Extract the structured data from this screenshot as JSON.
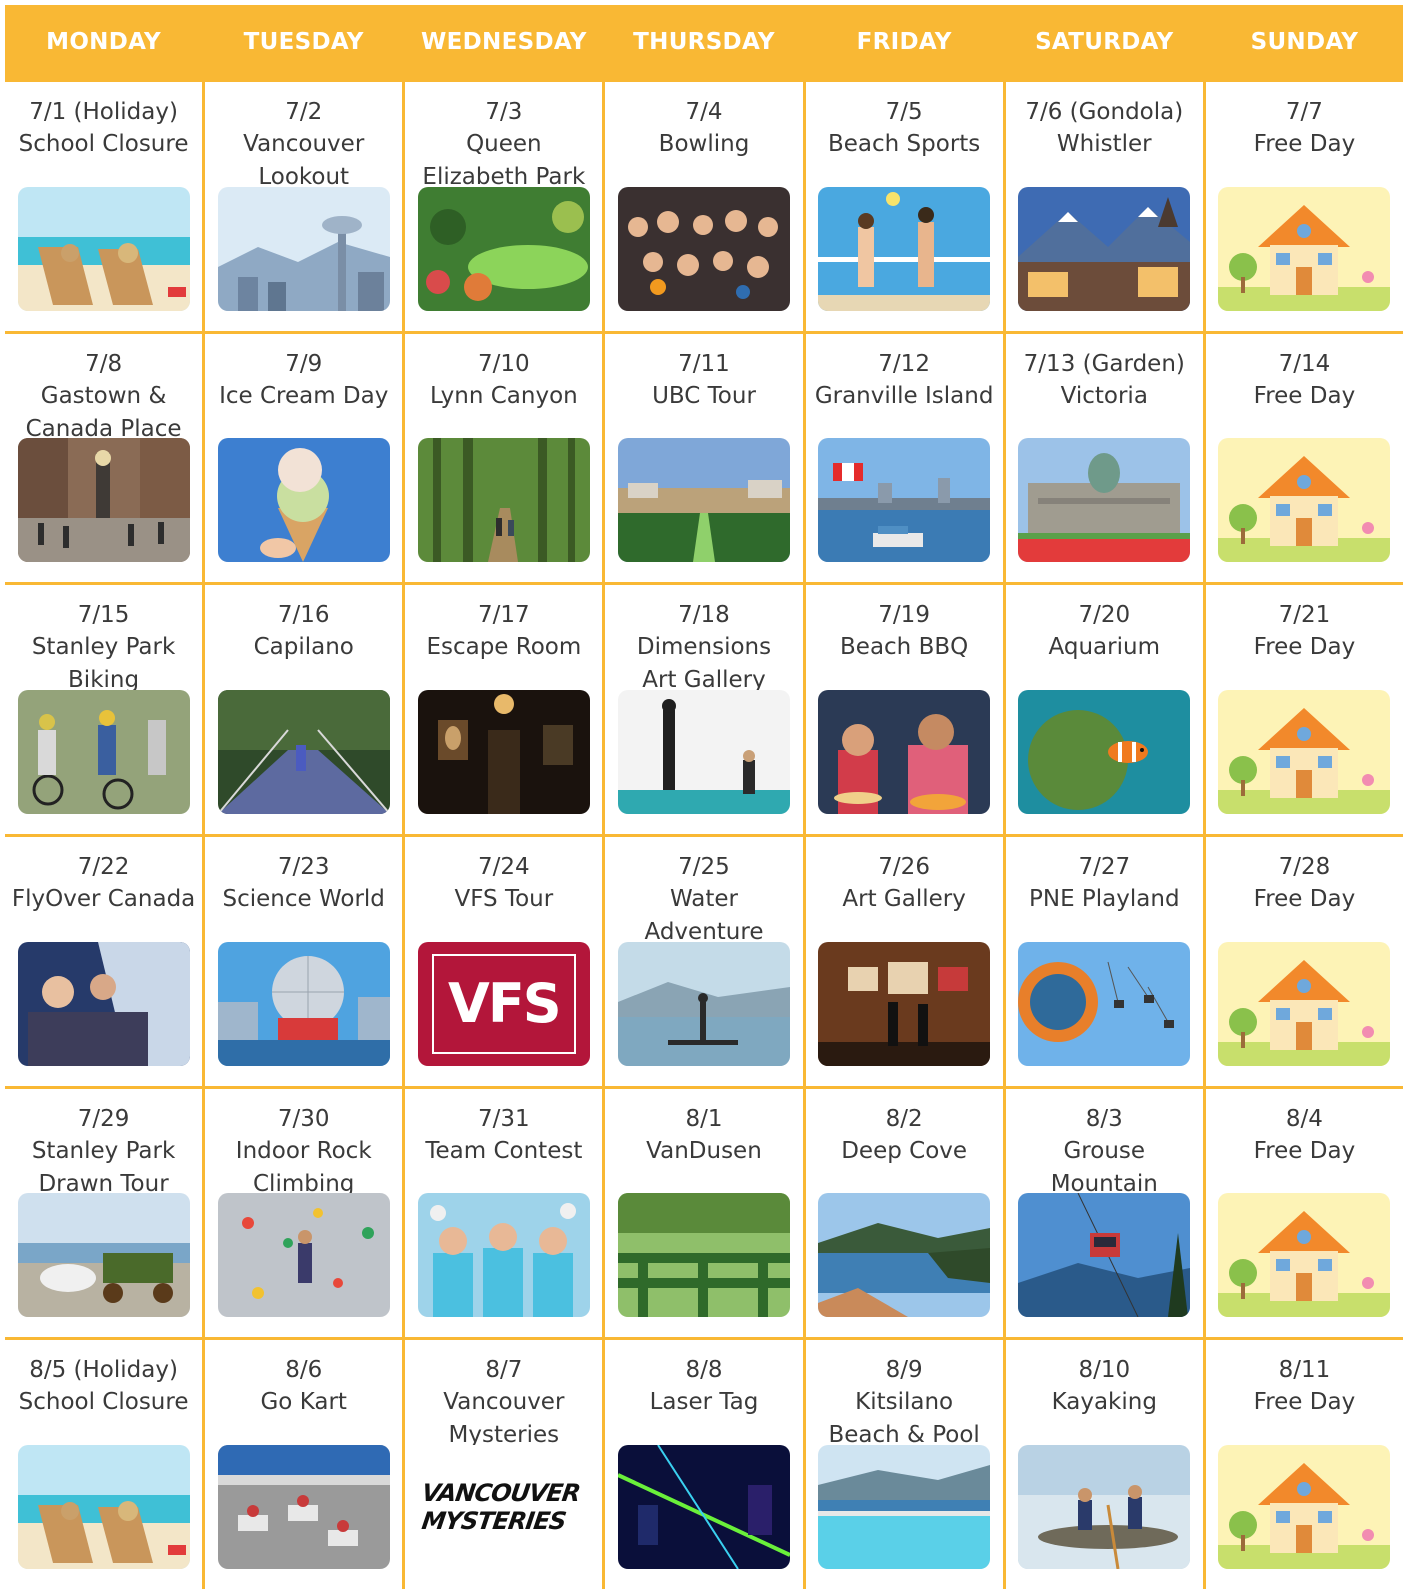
{
  "weekdays": [
    "MONDAY",
    "TUESDAY",
    "WEDNESDAY",
    "THURSDAY",
    "FRIDAY",
    "SATURDAY",
    "SUNDAY"
  ],
  "colors": {
    "accent": "#f9b834",
    "text": "#3a3a3a"
  },
  "days": [
    {
      "date": "7/1 (Holiday)",
      "title": "School Closure",
      "image": "beach-loungers"
    },
    {
      "date": "7/2",
      "title": "Vancouver\nLookout",
      "image": "city-tower"
    },
    {
      "date": "7/3",
      "title": "Queen\nElizabeth Park",
      "image": "garden"
    },
    {
      "date": "7/4",
      "title": "Bowling",
      "image": "group-photo"
    },
    {
      "date": "7/5",
      "title": "Beach Sports",
      "image": "volleyball"
    },
    {
      "date": "7/6 (Gondola)",
      "title": "Whistler",
      "image": "mountain-village"
    },
    {
      "date": "7/7",
      "title": "Free Day",
      "image": "house-cartoon"
    },
    {
      "date": "7/8",
      "title": "Gastown &\nCanada Place",
      "image": "street"
    },
    {
      "date": "7/9",
      "title": "Ice Cream Day",
      "image": "ice-cream"
    },
    {
      "date": "7/10",
      "title": "Lynn Canyon",
      "image": "forest"
    },
    {
      "date": "7/11",
      "title": "UBC Tour",
      "image": "campus"
    },
    {
      "date": "7/12",
      "title": "Granville Island",
      "image": "harbour"
    },
    {
      "date": "7/13 (Garden)",
      "title": "Victoria",
      "image": "parliament"
    },
    {
      "date": "7/14",
      "title": "Free Day",
      "image": "house-cartoon"
    },
    {
      "date": "7/15",
      "title": "Stanley Park\nBiking",
      "image": "biking"
    },
    {
      "date": "7/16",
      "title": "Capilano",
      "image": "bridge"
    },
    {
      "date": "7/17",
      "title": "Escape Room",
      "image": "dark-room"
    },
    {
      "date": "7/18",
      "title": "Dimensions\nArt Gallery",
      "image": "white-gallery"
    },
    {
      "date": "7/19",
      "title": "Beach BBQ",
      "image": "bbq"
    },
    {
      "date": "7/20",
      "title": "Aquarium",
      "image": "clownfish"
    },
    {
      "date": "7/21",
      "title": "Free Day",
      "image": "house-cartoon"
    },
    {
      "date": "7/22",
      "title": "FlyOver Canada",
      "image": "flyover"
    },
    {
      "date": "7/23",
      "title": "Science World",
      "image": "dome"
    },
    {
      "date": "7/24",
      "title": "VFS Tour",
      "image": "vfs-logo"
    },
    {
      "date": "7/25",
      "title": "Water\nAdventure",
      "image": "paddleboard"
    },
    {
      "date": "7/26",
      "title": "Art Gallery",
      "image": "gallery"
    },
    {
      "date": "7/27",
      "title": "PNE Playland",
      "image": "swing-ride"
    },
    {
      "date": "7/28",
      "title": "Free Day",
      "image": "house-cartoon"
    },
    {
      "date": "7/29",
      "title": "Stanley Park\nDrawn Tour",
      "image": "carriage"
    },
    {
      "date": "7/30",
      "title": "Indoor Rock\nClimbing",
      "image": "climbing-wall"
    },
    {
      "date": "7/31",
      "title": "Team Contest",
      "image": "cheering"
    },
    {
      "date": "8/1",
      "title": "VanDusen",
      "image": "hedge-maze"
    },
    {
      "date": "8/2",
      "title": "Deep Cove",
      "image": "cove"
    },
    {
      "date": "8/3",
      "title": "Grouse\nMountain",
      "image": "tram"
    },
    {
      "date": "8/4",
      "title": "Free Day",
      "image": "house-cartoon"
    },
    {
      "date": "8/5 (Holiday)",
      "title": "School Closure",
      "image": "beach-loungers"
    },
    {
      "date": "8/6",
      "title": "Go Kart",
      "image": "karts"
    },
    {
      "date": "8/7",
      "title": "Vancouver\nMysteries",
      "image": "mysteries-logo"
    },
    {
      "date": "8/8",
      "title": "Laser Tag",
      "image": "laser"
    },
    {
      "date": "8/9",
      "title": "Kitsilano\nBeach & Pool",
      "image": "pool"
    },
    {
      "date": "8/10",
      "title": "Kayaking",
      "image": "kayak"
    },
    {
      "date": "8/11",
      "title": "Free Day",
      "image": "house-cartoon"
    }
  ],
  "logos": {
    "vfs": "VFS",
    "mysteries_line1": "VANCOUVER",
    "mysteries_line2": "MYSTERIES"
  }
}
